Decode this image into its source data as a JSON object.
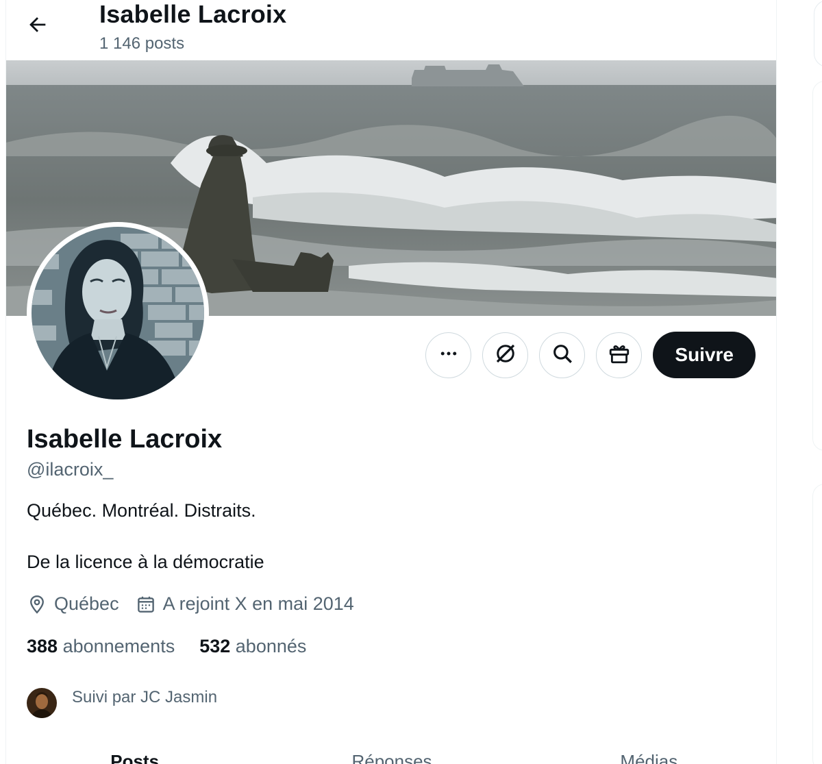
{
  "header": {
    "back_icon": "arrow-left-icon",
    "name": "Isabelle Lacroix",
    "post_count": "1 146 posts"
  },
  "actions": {
    "more_icon": "more-icon",
    "subscribe_icon": "grok-icon",
    "search_icon": "search-icon",
    "gift_icon": "gift-icon",
    "follow_label": "Suivre"
  },
  "profile": {
    "name": "Isabelle Lacroix",
    "handle": "@ilacroix_",
    "bio_line1": "Québec. Montréal. Distraits.",
    "bio_line2": "De la licence à la démocratie",
    "location": "Québec",
    "joined": "A rejoint X en mai 2014",
    "following_count": "388",
    "following_label": "abonnements",
    "followers_count": "532",
    "followers_label": "abonnés",
    "followed_by": "Suivi par JC Jasmin"
  },
  "tabs": [
    {
      "label": "Posts",
      "active": true
    },
    {
      "label": "Réponses",
      "active": false
    },
    {
      "label": "Médias",
      "active": false
    }
  ],
  "colors": {
    "text_primary": "#0f1419",
    "text_secondary": "#536471",
    "border": "#cfd9de",
    "follow_bg": "#0f1419"
  }
}
